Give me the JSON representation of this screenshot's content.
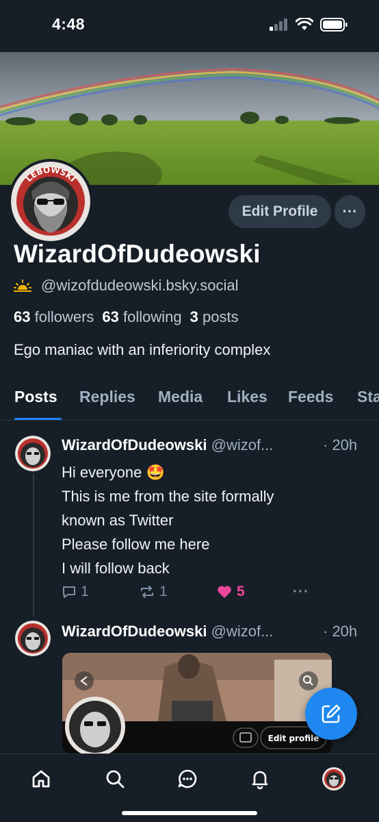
{
  "status_bar": {
    "time": "4:48"
  },
  "profile": {
    "display_name": "WizardOfDudeowski",
    "handle": "@wizofdudeowski.bsky.social",
    "followers_count": "63",
    "followers_label": "followers",
    "following_count": "63",
    "following_label": "following",
    "posts_count": "3",
    "posts_label": "posts",
    "bio": "Ego maniac with an inferiority complex",
    "edit_profile_label": "Edit Profile",
    "more_label": "···",
    "avatar_logo_text": "LEBOWSKI"
  },
  "tabs": [
    "Posts",
    "Replies",
    "Media",
    "Likes",
    "Feeds",
    "Sta"
  ],
  "posts": [
    {
      "author": "WizardOfDudeowski",
      "handle": "@wizof...",
      "time": "· 20h",
      "lines": [
        "Hi everyone 🤩",
        "This is me from the site formally",
        "known as Twitter",
        "Please follow me here",
        "I will follow back"
      ],
      "replies": "1",
      "reposts": "1",
      "likes": "5",
      "more": "···"
    },
    {
      "author": "WizardOfDudeowski",
      "handle": "@wizof...",
      "time": "· 20h",
      "embed_edit_label": "Edit profile"
    }
  ],
  "colors": {
    "accent": "#1e87f0",
    "like": "#ec4899",
    "background": "#161e27"
  },
  "icons": [
    "signal-icon",
    "wifi-icon",
    "battery-icon",
    "sunset-icon",
    "reply-icon",
    "repost-icon",
    "heart-icon",
    "compose-icon",
    "home-icon",
    "search-icon",
    "chat-icon",
    "bell-icon"
  ]
}
